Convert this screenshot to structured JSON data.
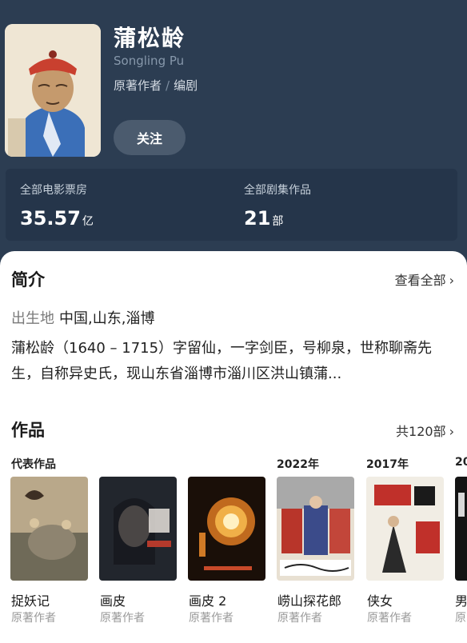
{
  "person": {
    "name": "蒲松龄",
    "en_name": "Songling Pu",
    "role_1": "原著作者",
    "role_sep": "/",
    "role_2": "编剧",
    "follow_label": "关注"
  },
  "stats": {
    "box_office_label": "全部电影票房",
    "box_office_value": "35.57",
    "box_office_unit": "亿",
    "series_label": "全部剧集作品",
    "series_value": "21",
    "series_unit": "部"
  },
  "intro": {
    "title": "简介",
    "see_all": "查看全部",
    "birth_key": "出生地",
    "birth_value": "中国,山东,淄博",
    "bio": "蒲松龄（1640 – 1715）字留仙，一字剑臣，号柳泉，世称聊斋先生，自称异史氏，现山东省淄博市淄川区洪山镇蒲..."
  },
  "works": {
    "title": "作品",
    "count": "共120部",
    "items": [
      {
        "tag": "代表作品",
        "title": "捉妖记",
        "role": "原著作者"
      },
      {
        "tag": "",
        "title": "画皮",
        "role": "原著作者"
      },
      {
        "tag": "",
        "title": "画皮 2",
        "role": "原著作者"
      },
      {
        "tag": "2022年",
        "title": "崂山探花郎",
        "role": "原著作者"
      },
      {
        "tag": "2017年",
        "title": "侠女",
        "role": "原著作者"
      },
      {
        "tag": "20",
        "title": "男",
        "role": "原"
      }
    ]
  },
  "colors": {
    "header_bg": "#2c3d52",
    "stats_bg": "#25354a",
    "accent_text": "#ffffff"
  }
}
